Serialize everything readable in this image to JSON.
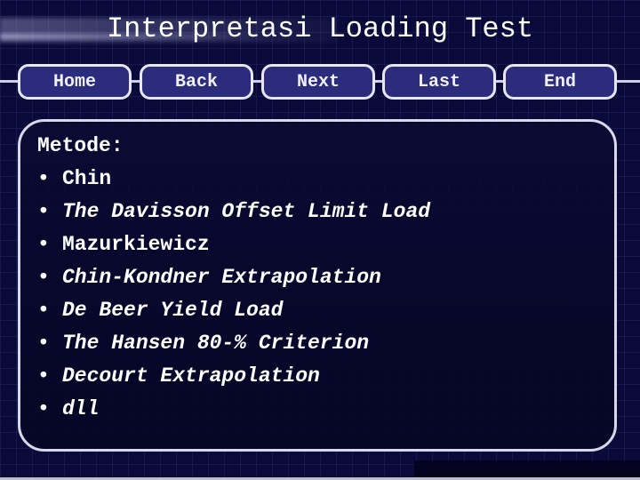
{
  "title": "Interpretasi Loading Test",
  "nav": {
    "buttons": [
      "Home",
      "Back",
      "Next",
      "Last",
      "End"
    ]
  },
  "content": {
    "heading": "Metode:",
    "items": [
      {
        "text": "Chin",
        "italic": false
      },
      {
        "text": "The Davisson Offset Limit Load",
        "italic": true
      },
      {
        "text": "Mazurkiewicz",
        "italic": false
      },
      {
        "text": "Chin-Kondner Extrapolation",
        "italic": true
      },
      {
        "text": "De Beer Yield Load",
        "italic": true
      },
      {
        "text": "The Hansen 80-% Criterion",
        "italic": true
      },
      {
        "text": "Decourt Extrapolation",
        "italic": true
      },
      {
        "text": "dll",
        "italic": true
      }
    ],
    "bullet": "•"
  },
  "colors": {
    "background": "#0a0a3a",
    "button": "#2c2c7c",
    "border": "#e6e6f4",
    "text": "#ffffff"
  }
}
